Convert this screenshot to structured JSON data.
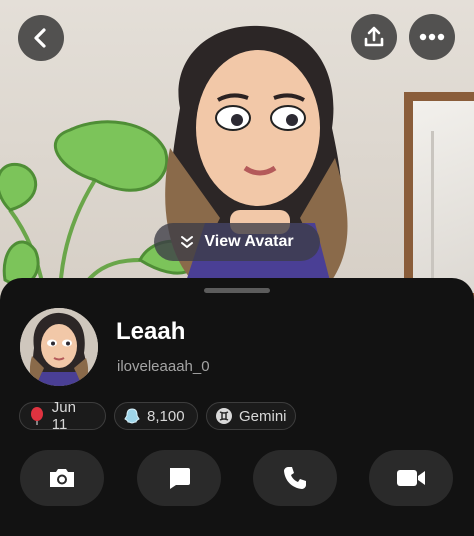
{
  "scene": {
    "view_avatar_label": "View Avatar"
  },
  "profile": {
    "display_name": "Leaah",
    "username": "iloveleaaah_0"
  },
  "chips": {
    "birthday": "Jun 11",
    "snap_score": "8,100",
    "zodiac": "Gemini"
  },
  "icons": {
    "back": "chevron-left-icon",
    "share": "share-icon",
    "more": "more-icon",
    "view_avatar": "double-chevron-down-icon",
    "birthday": "balloon-icon",
    "snap_score": "ghost-score-icon",
    "zodiac": "gemini-icon",
    "camera": "camera-icon",
    "chat": "chat-icon",
    "call": "phone-icon",
    "video": "video-icon"
  },
  "colors": {
    "sheet_background": "#121212",
    "button_background": "#2a2a2a",
    "balloon": "#e03340",
    "ghost": "#9fd6ea"
  }
}
